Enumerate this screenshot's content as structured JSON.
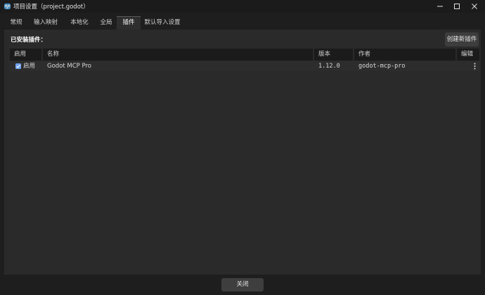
{
  "window": {
    "title": "项目设置（project.godot）"
  },
  "tabs": [
    {
      "label": "常规"
    },
    {
      "label": "输入映射"
    },
    {
      "label": "本地化"
    },
    {
      "label": "全局"
    },
    {
      "label": "插件",
      "active": true
    },
    {
      "label": "默认导入设置"
    }
  ],
  "plugins": {
    "section_title": "已安装插件：",
    "create_button": "创建新插件",
    "columns": {
      "enable": "启用",
      "name": "名称",
      "version": "版本",
      "author": "作者",
      "edit": "编辑"
    },
    "rows": [
      {
        "enabled": true,
        "enable_label": "启用",
        "name": "Godot MCP Pro",
        "version": "1.12.0",
        "author": "godot-mcp-pro"
      }
    ]
  },
  "footer": {
    "close_button": "关闭"
  },
  "colors": {
    "accent": "#6ea3f0",
    "panel": "#2a2a2a",
    "background": "#1e1e1e"
  }
}
